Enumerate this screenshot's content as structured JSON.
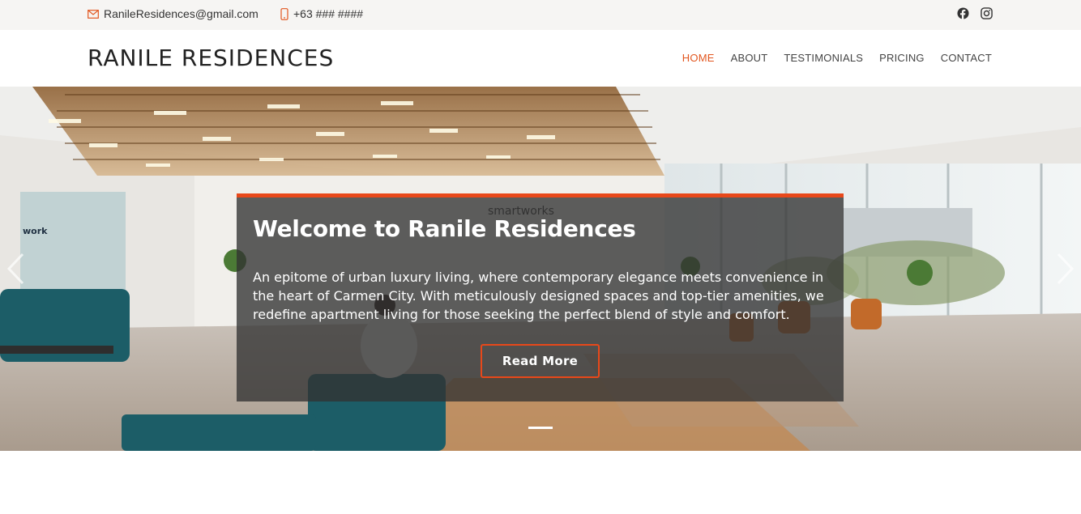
{
  "topbar": {
    "email": "RanileResidences@gmail.com",
    "phone": "+63 ### ####",
    "icons": [
      "envelope-icon",
      "phone-icon",
      "facebook-icon",
      "instagram-icon"
    ]
  },
  "header": {
    "brand": "RANILE RESIDENCES",
    "nav": [
      {
        "label": "HOME",
        "active": true
      },
      {
        "label": "ABOUT",
        "active": false
      },
      {
        "label": "TESTIMONIALS",
        "active": false
      },
      {
        "label": "PRICING",
        "active": false
      },
      {
        "label": "CONTACT",
        "active": false
      }
    ]
  },
  "hero": {
    "title": "Welcome to Ranile Residences",
    "text": "An epitome of urban luxury living, where contemporary elegance meets convenience in the heart of Carmen City. With meticulously designed spaces and top-tier amenities, we redefine apartment living for those seeking the perfect blend of style and comfort.",
    "button": "Read More",
    "sign_text": "smartworks",
    "wall_text": "work"
  },
  "colors": {
    "accent": "#e8481a",
    "active_nav": "#e2561f",
    "topbar_bg": "#f6f5f3"
  }
}
